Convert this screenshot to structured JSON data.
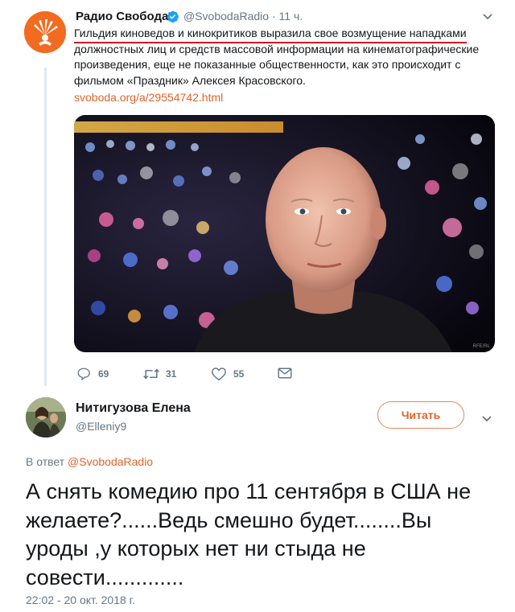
{
  "parent_tweet": {
    "author_name": "Радио Свобода",
    "handle": "@SvobodaRadio",
    "separator": "·",
    "time": "11 ч.",
    "text_highlighted": "Гильдия киноведов и кинокритиков выразила свое возмущение нападками",
    "text_rest": "должностных лиц и средств массовой информации на кинематографические произведения, еще не показанные общественности, как это происходит с фильмом «Праздник» Алексея Красовского.",
    "link": "svoboda.org/a/29554742.html",
    "photo_watermark": "RFE/RL",
    "actions": {
      "replies": "69",
      "retweets": "31",
      "likes": "55"
    }
  },
  "reply": {
    "author_name": "Нитигузова Елена",
    "handle": "@Elleniy9",
    "follow_label": "Читать",
    "reply_to_prefix": "В ответ",
    "reply_to_handle": "@SvobodaRadio",
    "text": "А снять комедию про 11 сентября в США не желаете?......Ведь смешно будет........Вы уроды ,у которых нет ни стыда не совести.............",
    "timestamp": "22:02 - 20 окт. 2018 г."
  },
  "colors": {
    "accent": "#e0642a",
    "brand_orange": "#f26b21",
    "verified": "#1da1f2",
    "underline_red": "#d01a22",
    "muted": "#657786"
  },
  "icons": [
    "verified-badge-icon",
    "chevron-down-icon",
    "reply-icon",
    "retweet-icon",
    "like-icon",
    "direct-message-icon"
  ]
}
